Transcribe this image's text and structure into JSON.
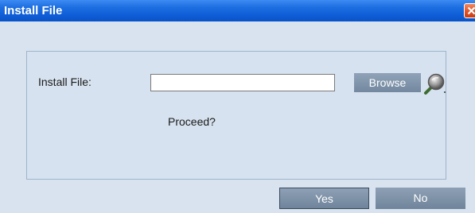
{
  "window": {
    "title": "Install File"
  },
  "form": {
    "install_file_label": "Install File:",
    "install_file_value": "",
    "install_file_placeholder": "",
    "browse_label": "Browse",
    "proceed_text": "Proceed?"
  },
  "actions": {
    "yes_label": "Yes",
    "no_label": "No"
  },
  "icons": {
    "close": "close-icon",
    "search": "search-icon"
  },
  "colors": {
    "titlebar": "#0f5ed8",
    "close_button": "#e0532a",
    "dialog_background": "#d8e3ef",
    "button": "#7f93aa"
  }
}
